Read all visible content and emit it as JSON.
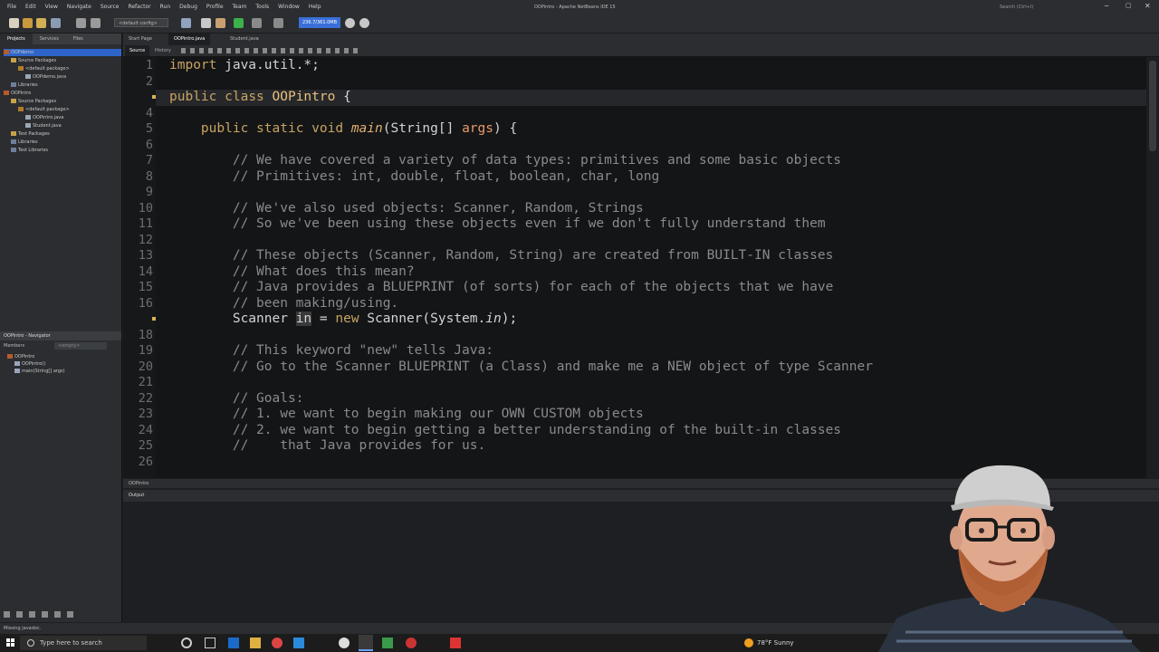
{
  "window": {
    "title": "OOPintro - Apache NetBeans IDE 15",
    "search_placeholder": "Search (Ctrl+I)"
  },
  "menu": [
    "File",
    "Edit",
    "View",
    "Navigate",
    "Source",
    "Refactor",
    "Run",
    "Debug",
    "Profile",
    "Team",
    "Tools",
    "Window",
    "Help"
  ],
  "toolbar": {
    "config": "<default config>",
    "memory": "236.7/361.0MB"
  },
  "projects_panel": {
    "tabs": [
      "Projects",
      "Services",
      "Files"
    ],
    "tree": [
      {
        "label": "OOPdemo",
        "type": "proj"
      },
      {
        "label": "Source Packages",
        "type": "fold"
      },
      {
        "label": "<default package>",
        "type": "pkg"
      },
      {
        "label": "OOPdemo.java",
        "type": "java"
      },
      {
        "label": "Libraries",
        "type": "lib"
      },
      {
        "label": "OOPintro",
        "type": "proj"
      },
      {
        "label": "Source Packages",
        "type": "fold"
      },
      {
        "label": "<default package>",
        "type": "pkg"
      },
      {
        "label": "OOPintro.java",
        "type": "java"
      },
      {
        "label": "Student.java",
        "type": "java"
      },
      {
        "label": "Test Packages",
        "type": "fold"
      },
      {
        "label": "Libraries",
        "type": "lib"
      },
      {
        "label": "Test Libraries",
        "type": "lib"
      }
    ]
  },
  "navigator_panel": {
    "title": "OOPintro - Navigator",
    "members_label": "Members",
    "filter": "<empty>",
    "tree": [
      "OOPintro",
      "OOPintro()",
      "main(String[] args)"
    ]
  },
  "editor": {
    "tabs": [
      "Start Page",
      "OOPintro.java",
      "Student.java"
    ],
    "modes": [
      "Source",
      "History"
    ],
    "lines": [
      {
        "n": "1",
        "t": "import java.util.*;"
      },
      {
        "n": "2",
        "t": ""
      },
      {
        "n": "",
        "t": "public class OOPintro {"
      },
      {
        "n": "4",
        "t": ""
      },
      {
        "n": "5",
        "t": "    public static void main(String[] args) {"
      },
      {
        "n": "6",
        "t": ""
      },
      {
        "n": "7",
        "t": "        // We have covered a variety of data types: primitives and some basic objects"
      },
      {
        "n": "8",
        "t": "        // Primitives: int, double, float, boolean, char, long"
      },
      {
        "n": "9",
        "t": ""
      },
      {
        "n": "10",
        "t": "        // We've also used objects: Scanner, Random, Strings"
      },
      {
        "n": "11",
        "t": "        // So we've been using these objects even if we don't fully understand them"
      },
      {
        "n": "12",
        "t": ""
      },
      {
        "n": "13",
        "t": "        // These objects (Scanner, Random, String) are created from BUILT-IN classes"
      },
      {
        "n": "14",
        "t": "        // What does this mean?"
      },
      {
        "n": "15",
        "t": "        // Java provides a BLUEPRINT (of sorts) for each of the objects that we have"
      },
      {
        "n": "16",
        "t": "        // been making/using."
      },
      {
        "n": "",
        "t": "        Scanner in = new Scanner(System.in);"
      },
      {
        "n": "18",
        "t": ""
      },
      {
        "n": "19",
        "t": "        // This keyword \"new\" tells Java:"
      },
      {
        "n": "20",
        "t": "        // Go to the Scanner BLUEPRINT (a Class) and make me a NEW object of type Scanner"
      },
      {
        "n": "21",
        "t": ""
      },
      {
        "n": "22",
        "t": "        // Goals:"
      },
      {
        "n": "23",
        "t": "        // 1. we want to begin making our OWN CUSTOM objects"
      },
      {
        "n": "24",
        "t": "        // 2. we want to begin getting a better understanding of the built-in classes"
      },
      {
        "n": "25",
        "t": "        //    that Java provides for us."
      },
      {
        "n": "26",
        "t": ""
      }
    ]
  },
  "breadcrumb": "OOPintro",
  "output": {
    "tab": "Output"
  },
  "status": {
    "text": "Missing javadoc."
  },
  "taskbar": {
    "search_placeholder": "Type here to search",
    "weather": "78°F  Sunny"
  }
}
